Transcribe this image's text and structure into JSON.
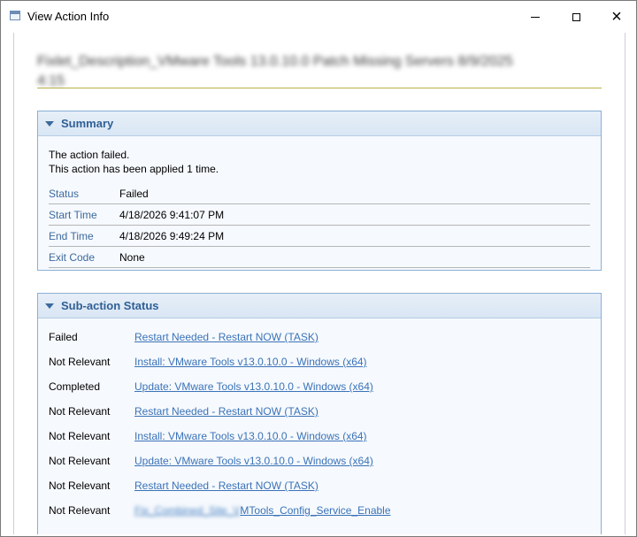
{
  "window": {
    "title": "View Action Info",
    "minimize_glyph": "minimize-icon",
    "maximize_glyph": "maximize-icon",
    "close_glyph": "×"
  },
  "header": {
    "blurred_title": "Fixlet_Description_VMware Tools 13.0.10.0 Patch Missing Servers 8/9/2025 4:15"
  },
  "summary": {
    "title": "Summary",
    "line1": "The action failed.",
    "line2": "This action has been applied 1 time.",
    "rows": [
      {
        "label": "Status",
        "value": "Failed"
      },
      {
        "label": "Start Time",
        "value": "4/18/2026 9:41:07 PM"
      },
      {
        "label": "End Time",
        "value": "4/18/2026 9:49:24 PM"
      },
      {
        "label": "Exit Code",
        "value": "None"
      }
    ]
  },
  "subactions": {
    "title": "Sub-action Status",
    "rows": [
      {
        "status": "Failed",
        "link": "Restart Needed - Restart NOW (TASK)"
      },
      {
        "status": "Not Relevant",
        "link": "Install: VMware Tools v13.0.10.0 - Windows (x64)"
      },
      {
        "status": "Completed",
        "link": "Update: VMware Tools v13.0.10.0 - Windows (x64)"
      },
      {
        "status": "Not Relevant",
        "link": "Restart Needed - Restart NOW (TASK)"
      },
      {
        "status": "Not Relevant",
        "link": "Install: VMware Tools v13.0.10.0 - Windows (x64)"
      },
      {
        "status": "Not Relevant",
        "link": "Update: VMware Tools v13.0.10.0 - Windows (x64)"
      },
      {
        "status": "Not Relevant",
        "link": "Restart Needed - Restart NOW (TASK)"
      },
      {
        "status": "Not Relevant",
        "link_blurred": "Fix_Combined_Site_V",
        "link": "MTools_Config_Service_Enable"
      }
    ]
  },
  "colors": {
    "panel_border": "#8ab0d6",
    "panel_title": "#2f5f96",
    "link": "#3a73b8",
    "rule": "#b8b246"
  }
}
